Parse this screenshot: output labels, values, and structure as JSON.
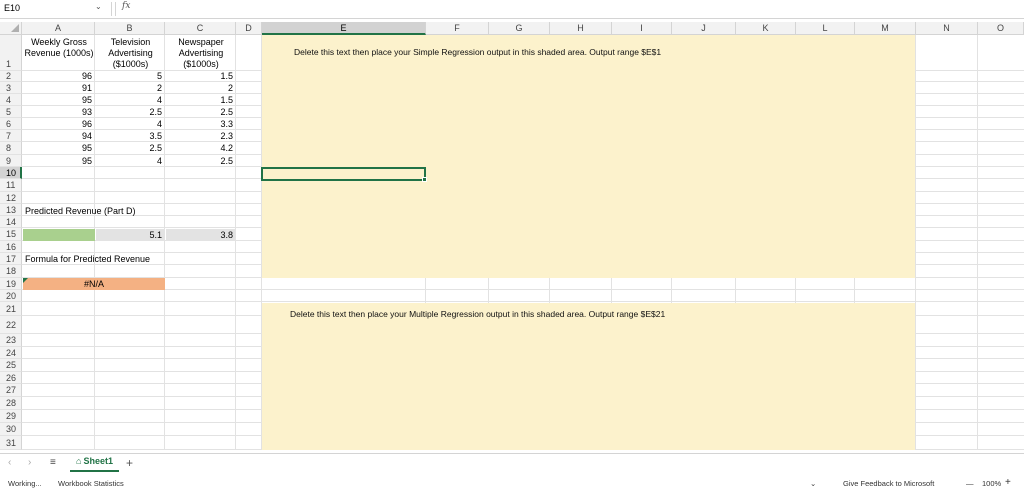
{
  "formula_bar": {
    "name_box": "E10",
    "fx_label": "fx",
    "formula": ""
  },
  "columns": [
    "A",
    "B",
    "C",
    "D",
    "E",
    "F",
    "G",
    "H",
    "I",
    "J",
    "K",
    "L",
    "M",
    "N",
    "O"
  ],
  "rows": [
    "1",
    "2",
    "3",
    "4",
    "5",
    "6",
    "7",
    "8",
    "9",
    "10",
    "11",
    "12",
    "13",
    "14",
    "15",
    "16",
    "17",
    "18",
    "19",
    "20",
    "21",
    "22",
    "23",
    "24",
    "25",
    "26",
    "27",
    "28",
    "29",
    "30",
    "31"
  ],
  "table": {
    "headers": {
      "a": "Weekly Gross Revenue (1000s)",
      "b": "Television Advertising ($1000s)",
      "c": "Newspaper Advertising ($1000s)"
    },
    "data": [
      [
        "96",
        "5",
        "1.5"
      ],
      [
        "91",
        "2",
        "2"
      ],
      [
        "95",
        "4",
        "1.5"
      ],
      [
        "93",
        "2.5",
        "2.5"
      ],
      [
        "96",
        "4",
        "3.3"
      ],
      [
        "94",
        "3.5",
        "2.3"
      ],
      [
        "95",
        "2.5",
        "4.2"
      ],
      [
        "95",
        "4",
        "2.5"
      ]
    ]
  },
  "predicted": {
    "label": "Predicted Revenue (Part D)",
    "tv_value": "5.1",
    "news_value": "3.8",
    "formula_label": "Formula for Predicted Revenue",
    "formula_result": "#N/A"
  },
  "shaded": {
    "simple_text": "Delete this text then place your Simple Regression output in this shaded area. Output range $E$1",
    "multiple_text": "Delete this text then place your Multiple Regression output in this shaded area. Output range $E$21",
    "color": "#fcf2cc"
  },
  "sheet_tabs": {
    "active": "Sheet1",
    "add_symbol": "+",
    "menu_symbol": "≡"
  },
  "status_bar": {
    "state": "Working...",
    "stats": "Workbook Statistics",
    "feedback": "Give Feedback to Microsoft",
    "zoom": "100%",
    "zoom_minus": "—",
    "zoom_plus": "+"
  },
  "accent_color": "#217346"
}
